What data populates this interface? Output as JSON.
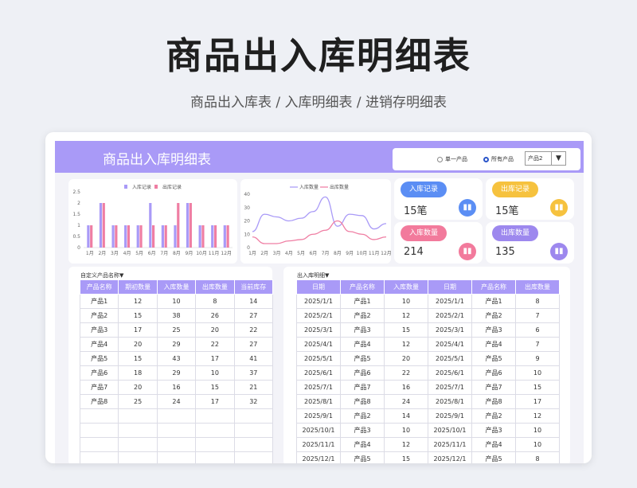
{
  "page": {
    "title": "商品出入库明细表",
    "subtitle": "商品出入库表 / 入库明细表 / 进销存明细表"
  },
  "banner": {
    "title": "商品出入库明细表",
    "radio_single": "单一产品",
    "radio_all": "所有产品",
    "select_value": "产品2",
    "arrow": "▼"
  },
  "kpis": [
    {
      "label": "入库记录",
      "value": "15笔",
      "color": "#5b8ef4",
      "icon": "bar-chart-icon"
    },
    {
      "label": "出库记录",
      "value": "15笔",
      "color": "#f6c23e",
      "icon": "bar-chart-icon"
    },
    {
      "label": "入库数量",
      "value": "214",
      "color": "#f27a9c",
      "icon": "bar-chart-icon"
    },
    {
      "label": "出库数量",
      "value": "135",
      "color": "#9d88ee",
      "icon": "bar-chart-icon"
    }
  ],
  "chart_data": [
    {
      "type": "bar",
      "legend": [
        "入库记录",
        "出库记录"
      ],
      "categories": [
        "1月",
        "2月",
        "3月",
        "4月",
        "5月",
        "6月",
        "7月",
        "8月",
        "9月",
        "10月",
        "11月",
        "12月"
      ],
      "series": [
        {
          "name": "入库记录",
          "values": [
            1,
            2,
            1,
            1,
            1,
            2,
            1,
            1,
            2,
            1,
            1,
            1
          ],
          "color": "#a99af7"
        },
        {
          "name": "出库记录",
          "values": [
            1,
            2,
            1,
            1,
            1,
            1,
            1,
            2,
            2,
            1,
            1,
            1
          ],
          "color": "#ef7ea3"
        }
      ],
      "yticks": [
        "0",
        "0.5",
        "1",
        "1.5",
        "2",
        "2.5"
      ],
      "ylim": [
        0,
        2.5
      ]
    },
    {
      "type": "line",
      "legend": [
        "入库数量",
        "出库数量"
      ],
      "categories": [
        "1月",
        "2月",
        "3月",
        "4月",
        "5月",
        "6月",
        "7月",
        "8月",
        "9月",
        "10月",
        "11月",
        "12月"
      ],
      "series": [
        {
          "name": "入库数量",
          "values": [
            12,
            25,
            23,
            20,
            22,
            27,
            38,
            16,
            25,
            24,
            14,
            18
          ],
          "color": "#a99af7"
        },
        {
          "name": "出库数量",
          "values": [
            8,
            3,
            3,
            5,
            6,
            10,
            13,
            20,
            12,
            10,
            6,
            8
          ],
          "color": "#ef7ea3"
        }
      ],
      "yticks": [
        "0",
        "10",
        "20",
        "30",
        "40"
      ],
      "ylim": [
        0,
        40
      ]
    }
  ],
  "left_table": {
    "title": "自定义产品名称▼",
    "headers": [
      "产品名称",
      "期初数量",
      "入库数量",
      "出库数量",
      "当前库存"
    ],
    "rows": [
      [
        "产品1",
        "12",
        "10",
        "8",
        "14"
      ],
      [
        "产品2",
        "15",
        "38",
        "26",
        "27"
      ],
      [
        "产品3",
        "17",
        "25",
        "20",
        "22"
      ],
      [
        "产品4",
        "20",
        "29",
        "22",
        "27"
      ],
      [
        "产品5",
        "15",
        "43",
        "17",
        "41"
      ],
      [
        "产品6",
        "18",
        "29",
        "10",
        "37"
      ],
      [
        "产品7",
        "20",
        "16",
        "15",
        "21"
      ],
      [
        "产品8",
        "25",
        "24",
        "17",
        "32"
      ],
      [
        "",
        "",
        "",
        "",
        ""
      ],
      [
        "",
        "",
        "",
        "",
        ""
      ],
      [
        "",
        "",
        "",
        "",
        ""
      ],
      [
        "",
        "",
        "",
        "",
        ""
      ]
    ]
  },
  "right_table": {
    "title": "出入库明细▼",
    "headers": [
      "日期",
      "产品名称",
      "入库数量",
      "日期",
      "产品名称",
      "出库数量"
    ],
    "rows": [
      [
        "2025/1/1",
        "产品1",
        "10",
        "2025/1/1",
        "产品1",
        "8"
      ],
      [
        "2025/2/1",
        "产品2",
        "12",
        "2025/2/1",
        "产品2",
        "7"
      ],
      [
        "2025/3/1",
        "产品3",
        "15",
        "2025/3/1",
        "产品3",
        "6"
      ],
      [
        "2025/4/1",
        "产品4",
        "12",
        "2025/4/1",
        "产品4",
        "7"
      ],
      [
        "2025/5/1",
        "产品5",
        "20",
        "2025/5/1",
        "产品5",
        "9"
      ],
      [
        "2025/6/1",
        "产品6",
        "22",
        "2025/6/1",
        "产品6",
        "10"
      ],
      [
        "2025/7/1",
        "产品7",
        "16",
        "2025/7/1",
        "产品7",
        "15"
      ],
      [
        "2025/8/1",
        "产品8",
        "24",
        "2025/8/1",
        "产品8",
        "17"
      ],
      [
        "2025/9/1",
        "产品2",
        "14",
        "2025/9/1",
        "产品2",
        "12"
      ],
      [
        "2025/10/1",
        "产品3",
        "10",
        "2025/10/1",
        "产品3",
        "10"
      ],
      [
        "2025/11/1",
        "产品4",
        "12",
        "2025/11/1",
        "产品4",
        "10"
      ],
      [
        "2025/12/1",
        "产品5",
        "15",
        "2025/12/1",
        "产品5",
        "8"
      ]
    ]
  }
}
